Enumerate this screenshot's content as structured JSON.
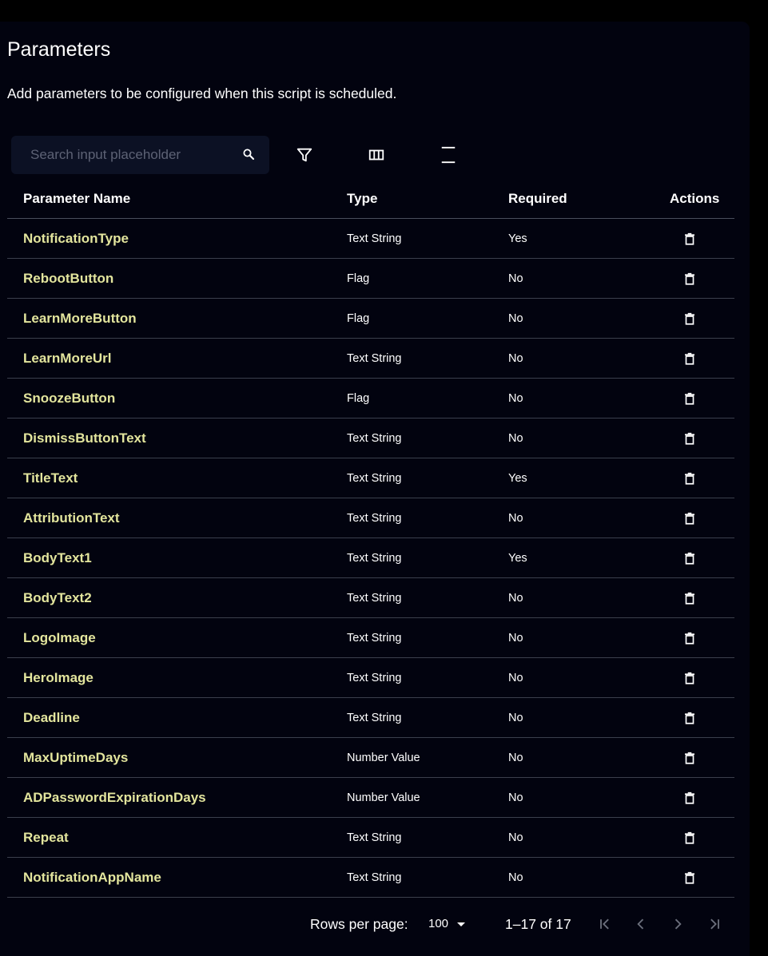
{
  "header": {
    "title": "Parameters",
    "subtitle": "Add parameters to be configured when this script is scheduled."
  },
  "toolbar": {
    "search_placeholder": "Search input placeholder",
    "search_value": "",
    "icons": [
      "search-icon",
      "filter-icon",
      "columns-icon",
      "density-icon"
    ]
  },
  "table": {
    "columns": [
      "Parameter Name",
      "Type",
      "Required",
      "Actions"
    ],
    "rows": [
      {
        "name": "NotificationType",
        "type": "Text String",
        "required": "Yes"
      },
      {
        "name": "RebootButton",
        "type": "Flag",
        "required": "No"
      },
      {
        "name": "LearnMoreButton",
        "type": "Flag",
        "required": "No"
      },
      {
        "name": "LearnMoreUrl",
        "type": "Text String",
        "required": "No"
      },
      {
        "name": "SnoozeButton",
        "type": "Flag",
        "required": "No"
      },
      {
        "name": "DismissButtonText",
        "type": "Text String",
        "required": "No"
      },
      {
        "name": "TitleText",
        "type": "Text String",
        "required": "Yes"
      },
      {
        "name": "AttributionText",
        "type": "Text String",
        "required": "No"
      },
      {
        "name": "BodyText1",
        "type": "Text String",
        "required": "Yes"
      },
      {
        "name": "BodyText2",
        "type": "Text String",
        "required": "No"
      },
      {
        "name": "LogoImage",
        "type": "Text String",
        "required": "No"
      },
      {
        "name": "HeroImage",
        "type": "Text String",
        "required": "No"
      },
      {
        "name": "Deadline",
        "type": "Text String",
        "required": "No"
      },
      {
        "name": "MaxUptimeDays",
        "type": "Number Value",
        "required": "No"
      },
      {
        "name": "ADPasswordExpirationDays",
        "type": "Number Value",
        "required": "No"
      },
      {
        "name": "Repeat",
        "type": "Text String",
        "required": "No"
      },
      {
        "name": "NotificationAppName",
        "type": "Text String",
        "required": "No"
      }
    ],
    "action_icon": "trash-icon"
  },
  "pagination": {
    "rows_per_page_label": "Rows per page:",
    "rows_per_page_value": "100",
    "range_text": "1–17 of 17"
  },
  "colors": {
    "background": "#000000",
    "panel": "#02030f",
    "name_accent": "#e3e59d",
    "search_bg": "#0c1124"
  }
}
